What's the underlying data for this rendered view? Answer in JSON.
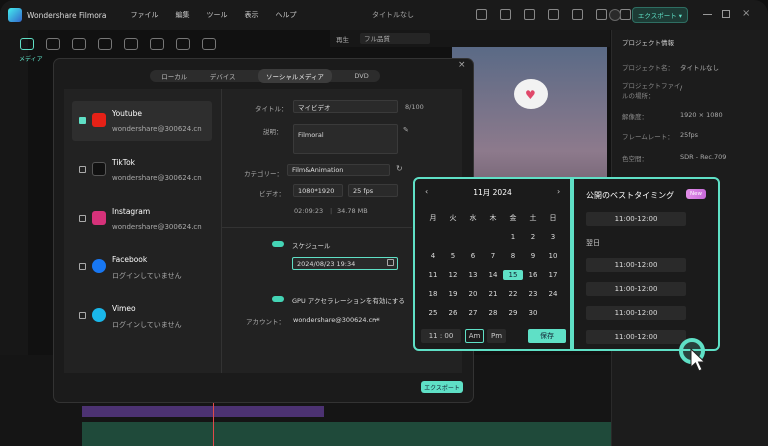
{
  "app": {
    "name": "Wondershare Filmora",
    "doc_title": "タイトルなし",
    "export_label": "エクスポート ▾"
  },
  "menu": [
    "ファイル",
    "編集",
    "ツール",
    "表示",
    "ヘルプ"
  ],
  "left_tabs": [
    "メディア"
  ],
  "preview_bar": {
    "label": "再生",
    "quality": "フル品質"
  },
  "right_panel": {
    "title": "プロジェクト情報",
    "rows": [
      {
        "k": "プロジェクト名：",
        "v": "タイトルなし"
      },
      {
        "k": "プロジェクトファイルの場所：",
        "v": "/"
      },
      {
        "k": "解像度：",
        "v": "1920 × 1080"
      },
      {
        "k": "フレームレート：",
        "v": "25fps"
      },
      {
        "k": "色空間：",
        "v": "SDR - Rec.709"
      }
    ]
  },
  "modal": {
    "tabs": [
      "ローカル",
      "デバイス",
      "ソーシャルメディア",
      "DVD"
    ],
    "active_tab": "ソーシャルメディア",
    "accounts": [
      {
        "name": "Youtube",
        "sub": "wondershare@300624.cn",
        "color": "#e62117"
      },
      {
        "name": "TikTok",
        "sub": "wondershare@300624.cn",
        "color": "#111111"
      },
      {
        "name": "Instagram",
        "sub": "wondershare@300624.cn",
        "color": "#d6327a"
      },
      {
        "name": "Facebook",
        "sub": "ログインしていません",
        "color": "#1877f2"
      },
      {
        "name": "Vimeo",
        "sub": "ログインしていません",
        "color": "#1ab7ea"
      }
    ],
    "form": {
      "title_label": "タイトル：",
      "title_value": "マイビデオ",
      "title_count": "8/100",
      "desc_label": "説明：",
      "desc_value": "Filmoral",
      "category_label": "カテゴリー：",
      "category_value": "Film&Animation",
      "video_label": "ビデオ：",
      "resolution": "1080*1920",
      "fps": "25 fps",
      "duration": "02:09:23",
      "size": "34.78 MB",
      "schedule_label": "スケジュール",
      "schedule_value": "2024/08/23  19:34",
      "gpu_label": "GPU アクセラレーションを有効にする",
      "account_label": "アカウント：",
      "account_value": "wondershare@300624.cn"
    },
    "export_label": "エクスポート"
  },
  "calendar": {
    "month_label": "11月  2024",
    "weekdays": [
      "月",
      "火",
      "水",
      "木",
      "金",
      "土",
      "日"
    ],
    "days": [
      "",
      "",
      "",
      "",
      "1",
      "2",
      "3",
      "4",
      "5",
      "6",
      "7",
      "8",
      "9",
      "10",
      "11",
      "12",
      "13",
      "14",
      "15",
      "16",
      "17",
      "18",
      "19",
      "20",
      "21",
      "22",
      "23",
      "24",
      "25",
      "26",
      "27",
      "28",
      "29",
      "30",
      ""
    ],
    "today": "15",
    "time": "11 : 00",
    "am": "Am",
    "pm": "Pm",
    "save": "保存"
  },
  "best_timing": {
    "title": "公開のベストタイミング",
    "badge": "New",
    "first_slot": "11:00-12:00",
    "day_label": "翌日",
    "slots": [
      "11:00-12:00",
      "11:00-12:00",
      "11:00-12:00",
      "11:00-12:00"
    ]
  }
}
